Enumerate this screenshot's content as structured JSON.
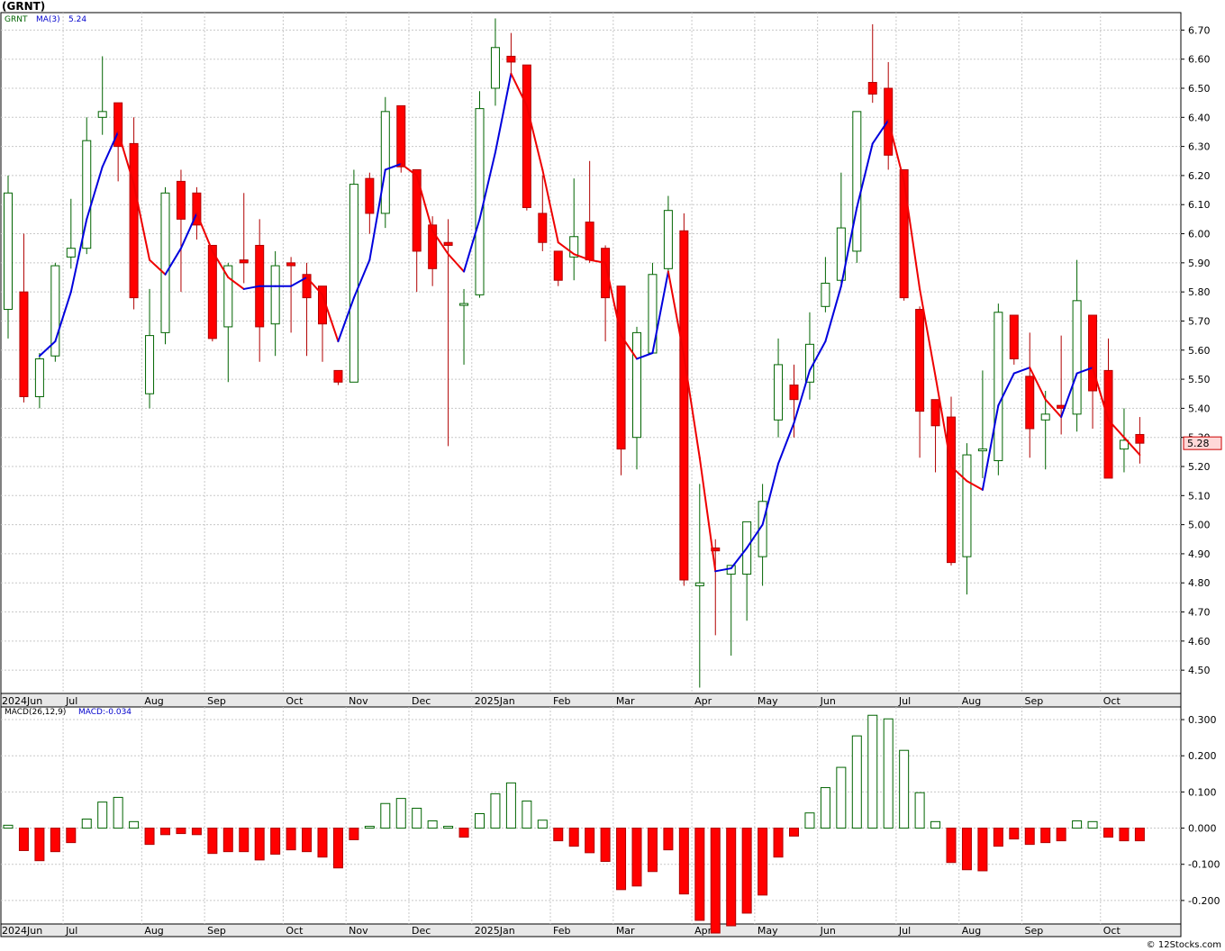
{
  "header": {
    "symbol_title": "(GRNT)"
  },
  "legend_price": {
    "symbol": "GRNT",
    "ma": "MA(3)",
    "ma_value": "5.24"
  },
  "legend_macd": {
    "label": "MACD(26,12,9)",
    "value": "MACD:-0.034"
  },
  "last_price_tag": "5.28",
  "footer": {
    "copyright": "© 12Stocks.com"
  },
  "colors": {
    "up": "#ffffff",
    "up_border": "#006400",
    "down": "#ff0000",
    "ma_up": "#0000dd",
    "ma_down": "#ee0000",
    "grid": "#c8c8c8",
    "axis_band": "#e8e8e8"
  },
  "chart_data": [
    {
      "type": "candlestick",
      "title": "(GRNT)",
      "ylim": [
        4.42,
        6.76
      ],
      "y_ticks": [
        "6.70",
        "6.60",
        "6.50",
        "6.40",
        "6.30",
        "6.20",
        "6.10",
        "6.00",
        "5.90",
        "5.80",
        "5.70",
        "5.60",
        "5.50",
        "5.40",
        "5.30",
        "5.20",
        "5.10",
        "5.00",
        "4.90",
        "4.80",
        "4.70",
        "4.60",
        "4.50"
      ],
      "x_labels": [
        "2024Jun",
        "Jul",
        "Aug",
        "Sep",
        "Oct",
        "Nov",
        "Dec",
        "2025Jan",
        "Feb",
        "Mar",
        "Apr",
        "May",
        "Jun",
        "Jul",
        "Aug",
        "Sep",
        "Oct"
      ],
      "x_label_week_index": [
        0,
        4,
        9,
        13,
        18,
        22,
        26,
        30,
        35,
        39,
        44,
        48,
        52,
        57,
        61,
        65,
        70
      ],
      "candles": [
        {
          "o": 5.74,
          "h": 6.2,
          "l": 5.64,
          "c": 6.14
        },
        {
          "o": 5.8,
          "h": 6.0,
          "l": 5.42,
          "c": 5.44
        },
        {
          "o": 5.44,
          "h": 5.59,
          "l": 5.4,
          "c": 5.57
        },
        {
          "o": 5.58,
          "h": 5.9,
          "l": 5.56,
          "c": 5.89
        },
        {
          "o": 5.92,
          "h": 6.12,
          "l": 5.88,
          "c": 5.95
        },
        {
          "o": 5.95,
          "h": 6.4,
          "l": 5.93,
          "c": 6.32
        },
        {
          "o": 6.4,
          "h": 6.61,
          "l": 6.34,
          "c": 6.42
        },
        {
          "o": 6.45,
          "h": 6.45,
          "l": 6.18,
          "c": 6.3
        },
        {
          "o": 6.31,
          "h": 6.4,
          "l": 5.74,
          "c": 5.78
        },
        {
          "o": 5.45,
          "h": 5.81,
          "l": 5.4,
          "c": 5.65
        },
        {
          "o": 5.66,
          "h": 6.16,
          "l": 5.62,
          "c": 6.14
        },
        {
          "o": 6.18,
          "h": 6.22,
          "l": 5.8,
          "c": 6.05
        },
        {
          "o": 6.14,
          "h": 6.16,
          "l": 5.98,
          "c": 6.03
        },
        {
          "o": 5.96,
          "h": 5.96,
          "l": 5.63,
          "c": 5.64
        },
        {
          "o": 5.68,
          "h": 5.9,
          "l": 5.49,
          "c": 5.89
        },
        {
          "o": 5.91,
          "h": 6.14,
          "l": 5.83,
          "c": 5.9
        },
        {
          "o": 5.96,
          "h": 6.05,
          "l": 5.56,
          "c": 5.68
        },
        {
          "o": 5.69,
          "h": 5.94,
          "l": 5.58,
          "c": 5.89
        },
        {
          "o": 5.9,
          "h": 5.92,
          "l": 5.66,
          "c": 5.89
        },
        {
          "o": 5.86,
          "h": 5.9,
          "l": 5.58,
          "c": 5.78
        },
        {
          "o": 5.82,
          "h": 5.82,
          "l": 5.56,
          "c": 5.69
        },
        {
          "o": 5.53,
          "h": 5.53,
          "l": 5.48,
          "c": 5.49
        },
        {
          "o": 5.49,
          "h": 6.22,
          "l": 5.49,
          "c": 6.17
        },
        {
          "o": 6.19,
          "h": 6.21,
          "l": 6.0,
          "c": 6.07
        },
        {
          "o": 6.07,
          "h": 6.47,
          "l": 6.02,
          "c": 6.42
        },
        {
          "o": 6.44,
          "h": 6.44,
          "l": 6.21,
          "c": 6.23
        },
        {
          "o": 6.22,
          "h": 6.22,
          "l": 5.8,
          "c": 5.94
        },
        {
          "o": 6.03,
          "h": 6.06,
          "l": 5.82,
          "c": 5.88
        },
        {
          "o": 5.97,
          "h": 6.05,
          "l": 5.27,
          "c": 5.96
        },
        {
          "o": 5.76,
          "h": 5.81,
          "l": 5.55,
          "c": 5.76
        },
        {
          "o": 5.79,
          "h": 6.49,
          "l": 5.78,
          "c": 6.43
        },
        {
          "o": 6.5,
          "h": 6.74,
          "l": 6.44,
          "c": 6.64
        },
        {
          "o": 6.61,
          "h": 6.69,
          "l": 6.55,
          "c": 6.59
        },
        {
          "o": 6.58,
          "h": 6.58,
          "l": 6.08,
          "c": 6.09
        },
        {
          "o": 6.07,
          "h": 6.2,
          "l": 5.94,
          "c": 5.97
        },
        {
          "o": 5.94,
          "h": 5.94,
          "l": 5.82,
          "c": 5.84
        },
        {
          "o": 5.92,
          "h": 6.19,
          "l": 5.84,
          "c": 5.99
        },
        {
          "o": 6.04,
          "h": 6.25,
          "l": 5.9,
          "c": 5.91
        },
        {
          "o": 5.95,
          "h": 5.96,
          "l": 5.63,
          "c": 5.78
        },
        {
          "o": 5.82,
          "h": 5.82,
          "l": 5.17,
          "c": 5.26
        },
        {
          "o": 5.3,
          "h": 5.68,
          "l": 5.19,
          "c": 5.66
        },
        {
          "o": 5.59,
          "h": 5.9,
          "l": 5.59,
          "c": 5.86
        },
        {
          "o": 5.88,
          "h": 6.13,
          "l": 5.86,
          "c": 6.08
        },
        {
          "o": 6.01,
          "h": 6.07,
          "l": 4.79,
          "c": 4.81
        },
        {
          "o": 4.79,
          "h": 5.14,
          "l": 4.44,
          "c": 4.8
        },
        {
          "o": 4.92,
          "h": 4.95,
          "l": 4.62,
          "c": 4.91
        },
        {
          "o": 4.83,
          "h": 4.84,
          "l": 4.55,
          "c": 4.86
        },
        {
          "o": 4.83,
          "h": 5.01,
          "l": 4.67,
          "c": 5.01
        },
        {
          "o": 4.89,
          "h": 5.14,
          "l": 4.79,
          "c": 5.08
        },
        {
          "o": 5.36,
          "h": 5.64,
          "l": 5.3,
          "c": 5.55
        },
        {
          "o": 5.48,
          "h": 5.55,
          "l": 5.3,
          "c": 5.43
        },
        {
          "o": 5.49,
          "h": 5.73,
          "l": 5.43,
          "c": 5.62
        },
        {
          "o": 5.75,
          "h": 5.92,
          "l": 5.73,
          "c": 5.83
        },
        {
          "o": 5.84,
          "h": 6.21,
          "l": 5.83,
          "c": 6.02
        },
        {
          "o": 5.94,
          "h": 6.42,
          "l": 5.9,
          "c": 6.42
        },
        {
          "o": 6.52,
          "h": 6.72,
          "l": 6.45,
          "c": 6.48
        },
        {
          "o": 6.5,
          "h": 6.59,
          "l": 6.22,
          "c": 6.27
        },
        {
          "o": 6.22,
          "h": 6.22,
          "l": 5.77,
          "c": 5.78
        },
        {
          "o": 5.74,
          "h": 5.75,
          "l": 5.23,
          "c": 5.39
        },
        {
          "o": 5.43,
          "h": 5.43,
          "l": 5.18,
          "c": 5.34
        },
        {
          "o": 5.37,
          "h": 5.44,
          "l": 4.86,
          "c": 4.87
        },
        {
          "o": 4.89,
          "h": 5.28,
          "l": 4.76,
          "c": 5.24
        },
        {
          "o": 5.26,
          "h": 5.53,
          "l": 5.16,
          "c": 5.26
        },
        {
          "o": 5.22,
          "h": 5.76,
          "l": 5.17,
          "c": 5.73
        },
        {
          "o": 5.72,
          "h": 5.72,
          "l": 5.55,
          "c": 5.57
        },
        {
          "o": 5.51,
          "h": 5.66,
          "l": 5.23,
          "c": 5.33
        },
        {
          "o": 5.36,
          "h": 5.46,
          "l": 5.19,
          "c": 5.38
        },
        {
          "o": 5.41,
          "h": 5.65,
          "l": 5.31,
          "c": 5.4
        },
        {
          "o": 5.38,
          "h": 5.91,
          "l": 5.32,
          "c": 5.77
        },
        {
          "o": 5.72,
          "h": 5.72,
          "l": 5.33,
          "c": 5.46
        },
        {
          "o": 5.53,
          "h": 5.64,
          "l": 5.16,
          "c": 5.16
        },
        {
          "o": 5.26,
          "h": 5.4,
          "l": 5.18,
          "c": 5.29
        },
        {
          "o": 5.31,
          "h": 5.37,
          "l": 5.21,
          "c": 5.28
        }
      ],
      "ma3": [
        null,
        null,
        5.58,
        5.63,
        5.8,
        6.05,
        6.23,
        6.35,
        6.17,
        5.91,
        5.86,
        5.95,
        6.07,
        5.94,
        5.85,
        5.81,
        5.82,
        5.82,
        5.82,
        5.85,
        5.79,
        5.63,
        5.78,
        5.91,
        6.22,
        6.24,
        6.2,
        6.01,
        5.93,
        5.87,
        6.05,
        6.28,
        6.55,
        6.44,
        6.22,
        5.97,
        5.93,
        5.91,
        5.9,
        5.65,
        5.57,
        5.59,
        5.87,
        5.58,
        5.23,
        4.84,
        4.85,
        4.92,
        5.0,
        5.21,
        5.35,
        5.53,
        5.63,
        5.82,
        6.09,
        6.31,
        6.39,
        6.18,
        5.81,
        5.51,
        5.2,
        5.15,
        5.12,
        5.41,
        5.52,
        5.54,
        5.43,
        5.37,
        5.52,
        5.54,
        5.36,
        5.3,
        5.24
      ]
    },
    {
      "type": "bar",
      "title": "MACD(26,12,9)",
      "ylim": [
        -0.265,
        0.335
      ],
      "y_ticks": [
        "0.300",
        "0.200",
        "0.100",
        "0.000",
        "-0.100",
        "-0.200"
      ],
      "values": [
        0.008,
        -0.062,
        -0.09,
        -0.065,
        -0.04,
        0.025,
        0.072,
        0.085,
        0.018,
        -0.045,
        -0.018,
        -0.015,
        -0.018,
        -0.07,
        -0.065,
        -0.065,
        -0.088,
        -0.072,
        -0.06,
        -0.065,
        -0.08,
        -0.11,
        -0.032,
        0.005,
        0.068,
        0.082,
        0.055,
        0.02,
        0.005,
        -0.025,
        0.04,
        0.095,
        0.125,
        0.075,
        0.022,
        -0.035,
        -0.05,
        -0.068,
        -0.092,
        -0.17,
        -0.16,
        -0.12,
        -0.06,
        -0.182,
        -0.255,
        -0.29,
        -0.27,
        -0.235,
        -0.185,
        -0.08,
        -0.022,
        0.042,
        0.112,
        0.168,
        0.255,
        0.312,
        0.302,
        0.215,
        0.098,
        0.018,
        -0.095,
        -0.115,
        -0.118,
        -0.05,
        -0.03,
        -0.045,
        -0.04,
        -0.035,
        0.02,
        0.018,
        -0.025,
        -0.035,
        -0.035
      ]
    }
  ]
}
